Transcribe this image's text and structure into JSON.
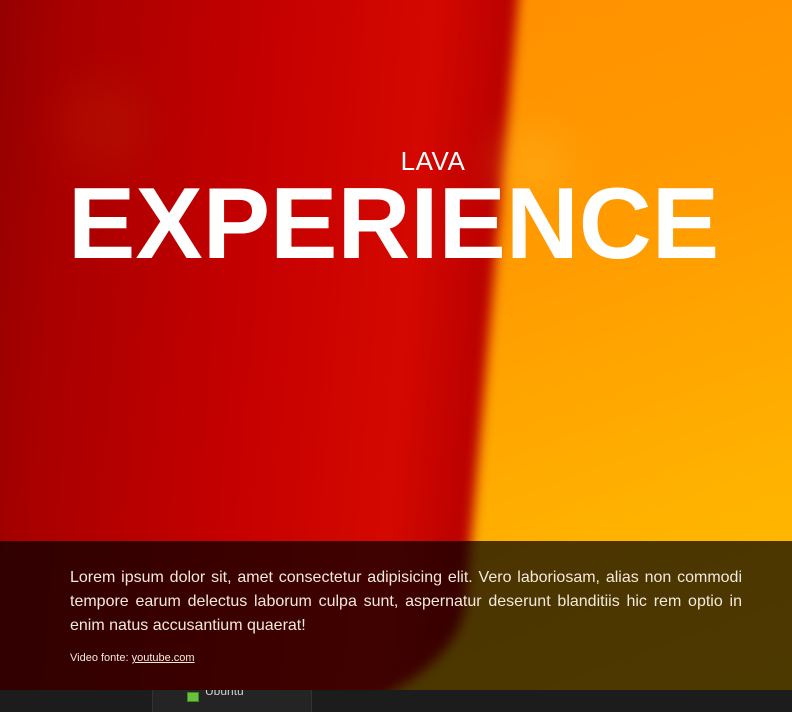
{
  "hero": {
    "pre_title": "LAVA",
    "title": "EXPERIENCE"
  },
  "caption": {
    "text": "Lorem ipsum dolor sit, amet consectetur adipisicing elit. Vero laboriosam, alias non commodi tempore earum delectus laborum culpa sunt, aspernatur deserunt blanditiis hic rem optio in enim natus accusantium quaerat!",
    "source_prefix": "Video fonte: ",
    "source_link": "youtube.com"
  },
  "taskbar": {
    "item_label": "Ubuntu",
    "item_icon": "vm-icon"
  },
  "colors": {
    "red": "#c40000",
    "orange": "#ff9a00",
    "caption_overlay": "rgba(0,0,0,0.7)"
  }
}
